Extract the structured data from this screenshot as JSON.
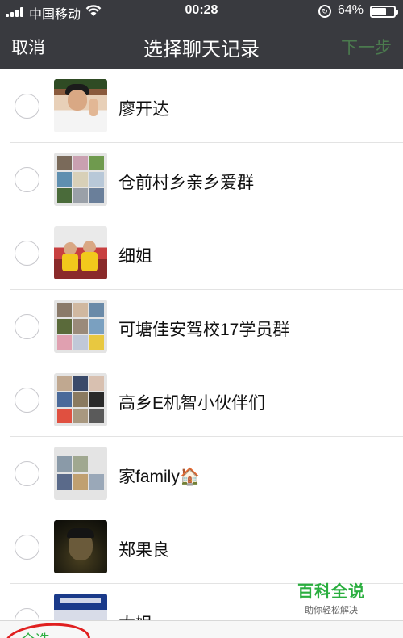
{
  "status_bar": {
    "carrier": "中国移动",
    "wifi_icon": "wifi-icon",
    "time": "00:28",
    "lock_icon": "orientation-lock-icon",
    "battery_percent": "64%",
    "battery_level": 0.64
  },
  "nav": {
    "cancel_label": "取消",
    "title": "选择聊天记录",
    "next_label": "下一步"
  },
  "chats": [
    {
      "name": "廖开达",
      "avatar": "person-photo"
    },
    {
      "name": "仓前村乡亲乡爱群",
      "avatar": "group-grid"
    },
    {
      "name": "细姐",
      "avatar": "children-photo"
    },
    {
      "name": "可塘佳安驾校17学员群",
      "avatar": "group-grid"
    },
    {
      "name": "高乡E机智小伙伴们",
      "avatar": "group-grid"
    },
    {
      "name": "家family🏠",
      "avatar": "group-grid"
    },
    {
      "name": "郑果良",
      "avatar": "person-photo"
    },
    {
      "name": "大姐",
      "avatar": "storefront-photo"
    }
  ],
  "bottom": {
    "select_all_label": "全选"
  },
  "watermark": {
    "title": "百科全说",
    "subtitle": "助你轻松解决"
  },
  "colors": {
    "header_bg": "#393a3f",
    "accent_green": "#2aae3f",
    "annotation_red": "#e02020"
  }
}
